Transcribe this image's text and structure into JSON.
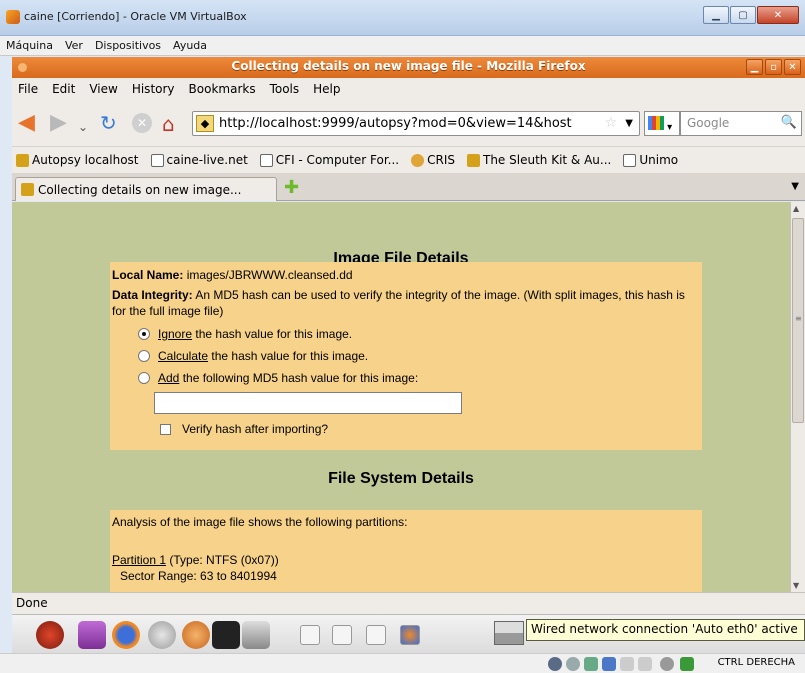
{
  "vbox": {
    "title": "caine [Corriendo] - Oracle VM VirtualBox",
    "menu": [
      "Máquina",
      "Ver",
      "Dispositivos",
      "Ayuda"
    ],
    "status_label": "CTRL DERECHA"
  },
  "firefox": {
    "title": "Collecting details on new image file - Mozilla Firefox",
    "menu": [
      "File",
      "Edit",
      "View",
      "History",
      "Bookmarks",
      "Tools",
      "Help"
    ],
    "url": "http://localhost:9999/autopsy?mod=0&view=14&host",
    "search_placeholder": "Google",
    "bookmarks": [
      "Autopsy localhost",
      "caine-live.net",
      "CFI - Computer For...",
      "CRIS",
      "The Sleuth Kit & Au...",
      "Unimo"
    ],
    "tab_label": "Collecting details on new image...",
    "status": "Done"
  },
  "page": {
    "image_details_title": "Image File Details",
    "local_name_label": "Local Name:",
    "local_name_value": "images/JBRWWW.cleansed.dd",
    "integrity_label": "Data Integrity:",
    "integrity_text": "An MD5 hash can be used to verify the integrity of the image. (With split images, this hash is for the full image file)",
    "options": [
      {
        "link": "Ignore",
        "rest": "the hash value for this image.",
        "selected": true
      },
      {
        "link": "Calculate",
        "rest": "the hash value for this image.",
        "selected": false
      },
      {
        "link": "Add",
        "rest": "the following MD5 hash value for this image:",
        "selected": false
      }
    ],
    "md5_value": "",
    "verify_label": "Verify hash after importing?",
    "fs_title": "File System Details",
    "analysis_text": "Analysis of the image file shows the following partitions:",
    "partition_link": "Partition 1",
    "partition_type": "(Type: NTFS (0x07))",
    "sector_range": "Sector Range: 63 to 8401994"
  },
  "tooltip": "Wired network connection 'Auto eth0' active"
}
